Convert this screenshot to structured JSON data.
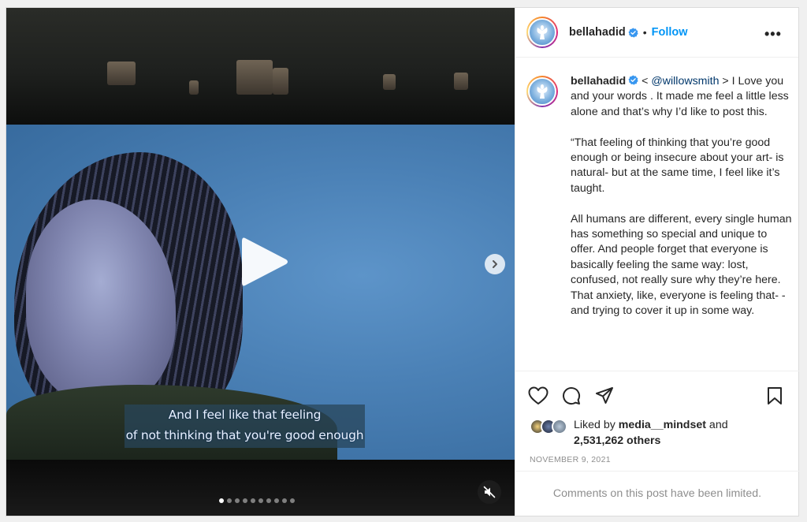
{
  "post": {
    "username": "bellahadid",
    "header_separator": "•",
    "follow_label": "Follow",
    "more_label": "•••"
  },
  "media": {
    "subtitle_line1": "And I feel like that feeling",
    "subtitle_line2": "of not thinking that you're good enough",
    "carousel_count": 10,
    "carousel_active": 1
  },
  "caption": {
    "username": "bellahadid",
    "mention_prefix": " < ",
    "mention": "@willowsmith",
    "intro": " > I Love you and your words . It made me feel a little less alone and that’s why I’d like to post this.",
    "para2": "“That feeling of thinking that you’re good enough or being insecure about your art- is natural- but at the same time, I feel like it’s taught.",
    "para3": "All humans are different, every single human has something so special and unique to offer. And people forget that everyone is basically feeling the same way: lost, confused, not really sure why they’re here. That anxiety, like, everyone is feeling that- - and trying to cover it up in some way."
  },
  "likes": {
    "prefix": "Liked by ",
    "user": "media__mindset",
    "middle": " and",
    "count": "2,531,262 others"
  },
  "date": "NOVEMBER 9, 2021",
  "comments_limited": "Comments on this post have been limited.",
  "colors": {
    "accent": "#0095f6",
    "verified": "#3897f0",
    "muted": "#8e8e8e"
  }
}
